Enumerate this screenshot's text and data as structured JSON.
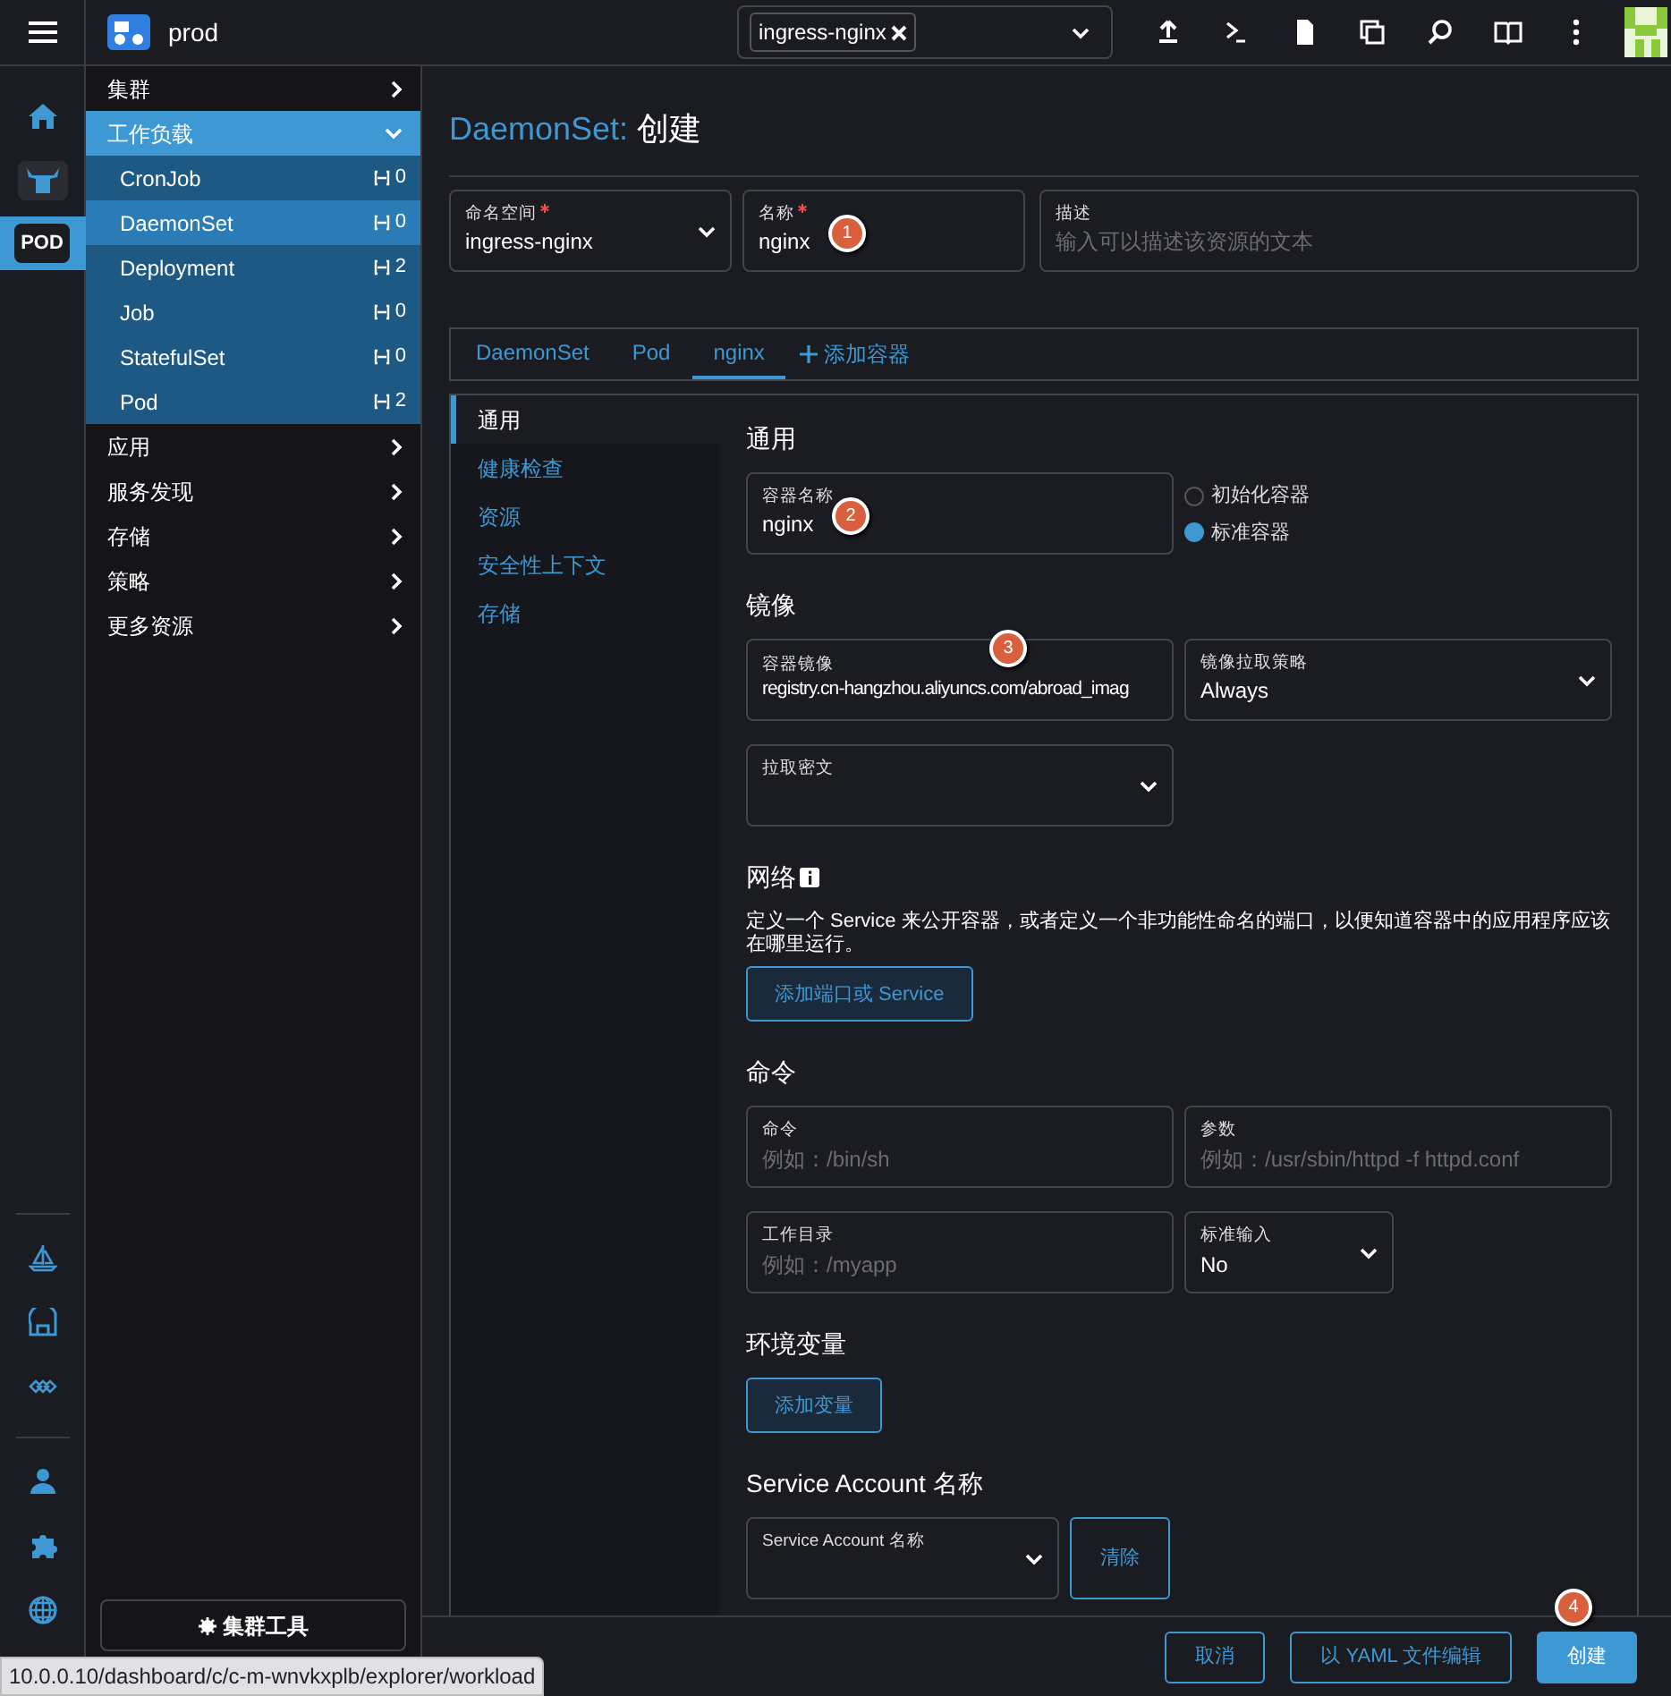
{
  "topbar": {
    "cluster": "prod",
    "namespace_chips": [
      "ingress-nginx"
    ]
  },
  "rail": [
    {
      "kind": "home",
      "selected": false
    },
    {
      "kind": "bull",
      "selected": false
    },
    {
      "kind": "label",
      "label": "POD",
      "selected": true
    }
  ],
  "nav": [
    {
      "label": "集群",
      "expanded": false
    },
    {
      "label": "工作负载",
      "expanded": true,
      "children": [
        {
          "label": "CronJob",
          "count": "0",
          "selected": false
        },
        {
          "label": "DaemonSet",
          "count": "0",
          "selected": true
        },
        {
          "label": "Deployment",
          "count": "2",
          "selected": false
        },
        {
          "label": "Job",
          "count": "0",
          "selected": false
        },
        {
          "label": "StatefulSet",
          "count": "0",
          "selected": false
        },
        {
          "label": "Pod",
          "count": "2",
          "selected": false
        }
      ]
    },
    {
      "label": "应用",
      "expanded": false
    },
    {
      "label": "服务发现",
      "expanded": false
    },
    {
      "label": "存储",
      "expanded": false
    },
    {
      "label": "策略",
      "expanded": false
    },
    {
      "label": "更多资源",
      "expanded": false
    }
  ],
  "cluster_tools_button": "集群工具",
  "page_title": {
    "resource": "DaemonSet:",
    "action": "创建"
  },
  "meta_fields": [
    {
      "kind": "select",
      "label": "命名空间",
      "required": true,
      "value": "ingress-nginx"
    },
    {
      "kind": "input",
      "label": "名称",
      "required": true,
      "value": "nginx",
      "marker": "1"
    },
    {
      "kind": "input",
      "label": "描述",
      "required": false,
      "placeholder": "输入可以描述该资源的文本"
    }
  ],
  "tabs": [
    {
      "label": "DaemonSet",
      "selected": false
    },
    {
      "label": "Pod",
      "selected": false
    },
    {
      "label": "nginx",
      "selected": true
    }
  ],
  "add_container": "添加容器",
  "side_menu": [
    {
      "label": "通用",
      "selected": true
    },
    {
      "label": "健康检查",
      "selected": false
    },
    {
      "label": "资源",
      "selected": false
    },
    {
      "label": "安全性上下文",
      "selected": false
    },
    {
      "label": "存储",
      "selected": false
    }
  ],
  "sections": [
    {
      "kind": "general",
      "title": "通用",
      "field": {
        "kind": "input",
        "label": "容器名称",
        "value": "nginx",
        "marker": "2"
      },
      "radios": [
        {
          "label": "初始化容器",
          "selected": false
        },
        {
          "label": "标准容器",
          "selected": true
        }
      ]
    },
    {
      "kind": "fields",
      "title": "镜像",
      "rows": [
        [
          {
            "kind": "input",
            "label": "容器镜像",
            "value": "registry.cn-hangzhou.aliyuncs.com/abroad_imag",
            "marker": "3"
          },
          {
            "kind": "select",
            "label": "镜像拉取策略",
            "value": "Always"
          }
        ],
        [
          {
            "kind": "select",
            "label": "拉取密文"
          }
        ]
      ]
    },
    {
      "kind": "button",
      "title": "网络",
      "info": true,
      "description": "定义一个 Service 来公开容器，或者定义一个非功能性命名的端口，以便知道容器中的应用程序应该在哪里运行。",
      "button": "添加端口或 Service"
    },
    {
      "kind": "fields",
      "title": "命令",
      "rows": [
        [
          {
            "kind": "input",
            "label": "命令",
            "placeholder": "例如：/bin/sh"
          },
          {
            "kind": "input",
            "label": "参数",
            "placeholder": "例如：/usr/sbin/httpd -f httpd.conf"
          }
        ],
        [
          {
            "kind": "input",
            "label": "工作目录",
            "placeholder": "例如：/myapp"
          },
          {
            "kind": "select",
            "label": "标准输入",
            "value": "No",
            "narrow": true
          }
        ]
      ]
    },
    {
      "kind": "button",
      "title": "环境变量",
      "button": "添加变量"
    },
    {
      "kind": "account",
      "title": "Service Account 名称",
      "field": {
        "kind": "select",
        "label": "Service Account 名称"
      },
      "button": "清除"
    }
  ],
  "footer_buttons": [
    {
      "kind": "outline",
      "label": "取消"
    },
    {
      "kind": "outline",
      "label": "以 YAML 文件编辑"
    },
    {
      "kind": "primary",
      "label": "创建",
      "marker": "4"
    }
  ],
  "status_url": "10.0.0.10/dashboard/c/c-m-wnvkxplb/explorer/workload"
}
